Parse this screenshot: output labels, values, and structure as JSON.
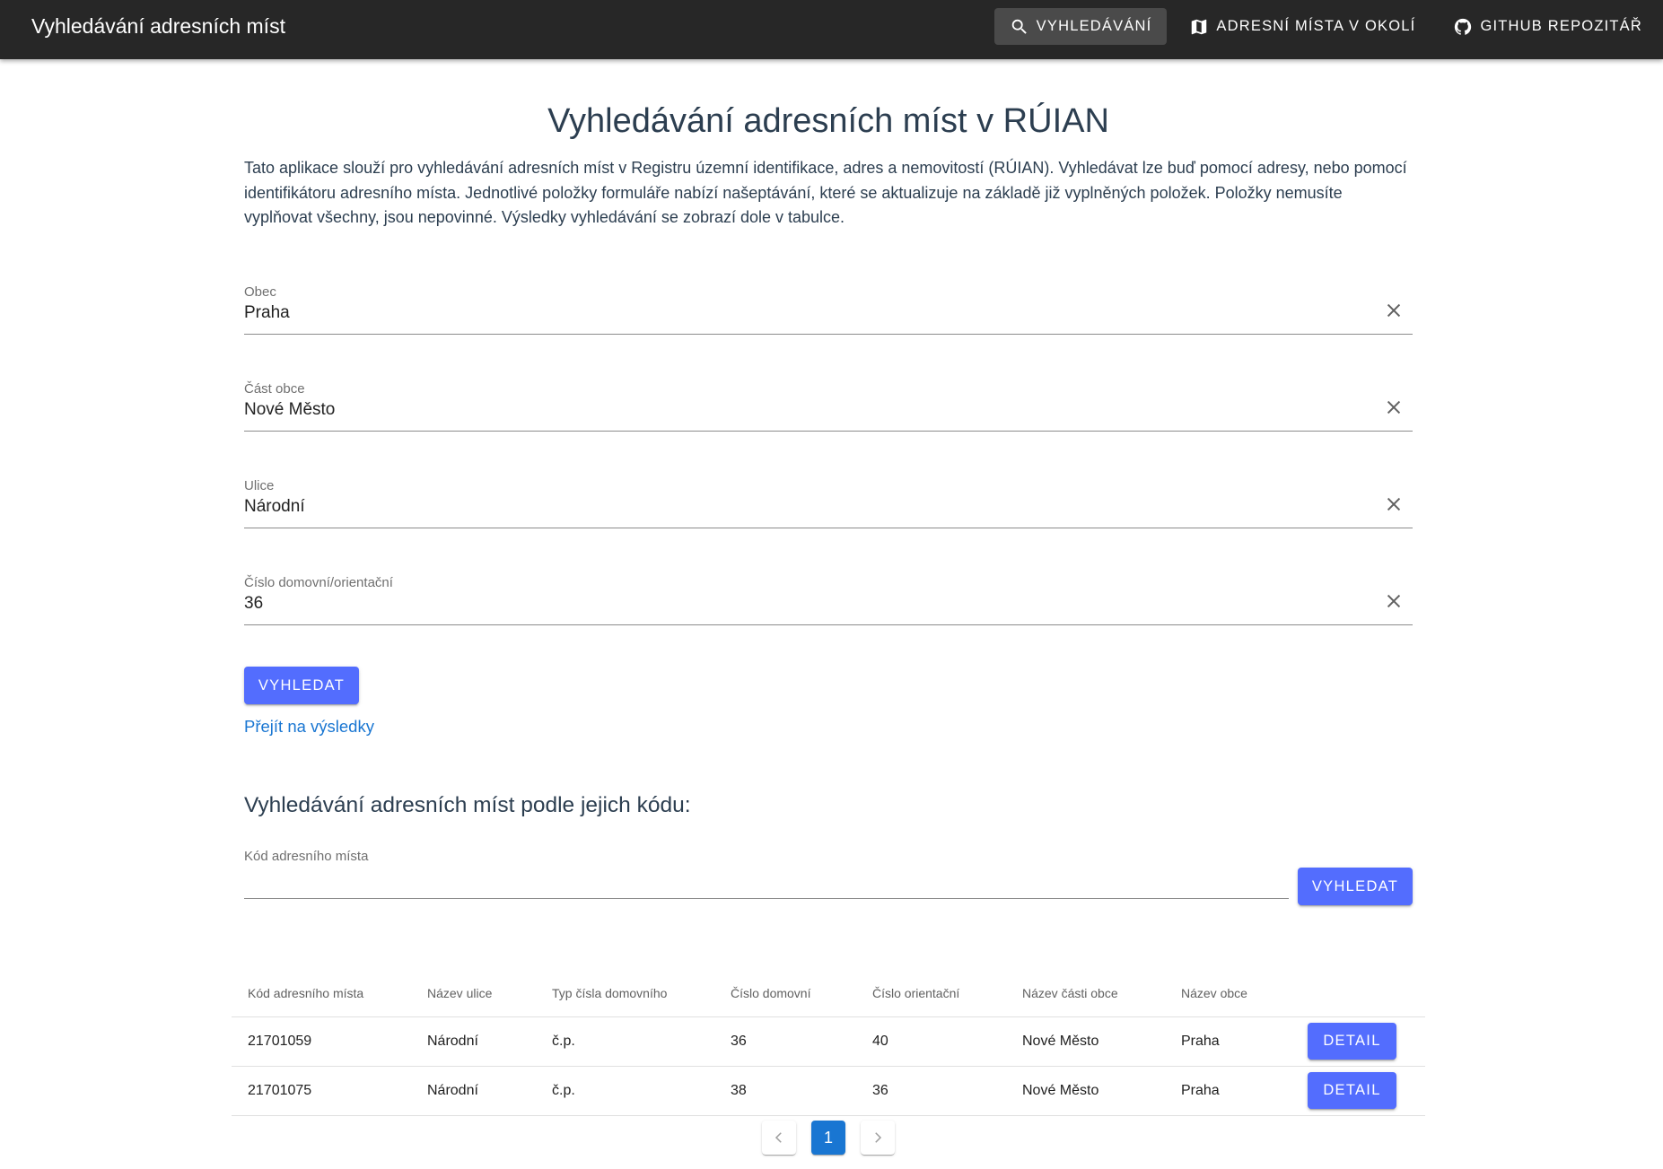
{
  "appbar": {
    "title": "Vyhledávání adresních míst",
    "nav": [
      {
        "label": "Vyhledávání",
        "icon": "search-icon",
        "active": true
      },
      {
        "label": "Adresní místa v okolí",
        "icon": "map-icon",
        "active": false
      },
      {
        "label": "GitHub repozitář",
        "icon": "github-icon",
        "active": false
      }
    ]
  },
  "main": {
    "title": "Vyhledávání adresních míst v RÚIAN",
    "intro": "Tato aplikace slouží pro vyhledávání adresních míst v Registru územní identifikace, adres a nemovitostí (RÚIAN). Vyhledávat lze buď pomocí adresy, nebo pomocí identifikátoru adresního místa. Jednotlivé položky formuláře nabízí našeptávání, které se aktualizuje na základě již vyplněných položek. Položky nemusíte vyplňovat všechny, jsou nepovinné. Výsledky vyhledávání se zobrazí dole v tabulce."
  },
  "form": {
    "fields": [
      {
        "label": "Obec",
        "value": "Praha"
      },
      {
        "label": "Část obce",
        "value": "Nové Město"
      },
      {
        "label": "Ulice",
        "value": "Národní"
      },
      {
        "label": "Číslo domovní/orientační",
        "value": "36"
      }
    ],
    "search_label": "Vyhledat",
    "results_link": "Přejít na výsledky"
  },
  "code_search": {
    "title": "Vyhledávání adresních míst podle jejich kódu:",
    "field_label": "Kód adresního místa",
    "field_value": "",
    "search_label": "Vyhledat"
  },
  "table": {
    "headers": [
      "Kód adresního místa",
      "Název ulice",
      "Typ čísla domovního",
      "Číslo domovní",
      "Číslo orientační",
      "Název části obce",
      "Název obce"
    ],
    "rows": [
      [
        "21701059",
        "Národní",
        "č.p.",
        "36",
        "40",
        "Nové Město",
        "Praha"
      ],
      [
        "21701075",
        "Národní",
        "č.p.",
        "38",
        "36",
        "Nové Město",
        "Praha"
      ]
    ],
    "detail_label": "Detail"
  },
  "pagination": {
    "current_page": "1"
  },
  "colors": {
    "appbar": "#272727",
    "primary_button": "#536dfe",
    "link": "#1976d2",
    "active_page": "#1976d2"
  }
}
